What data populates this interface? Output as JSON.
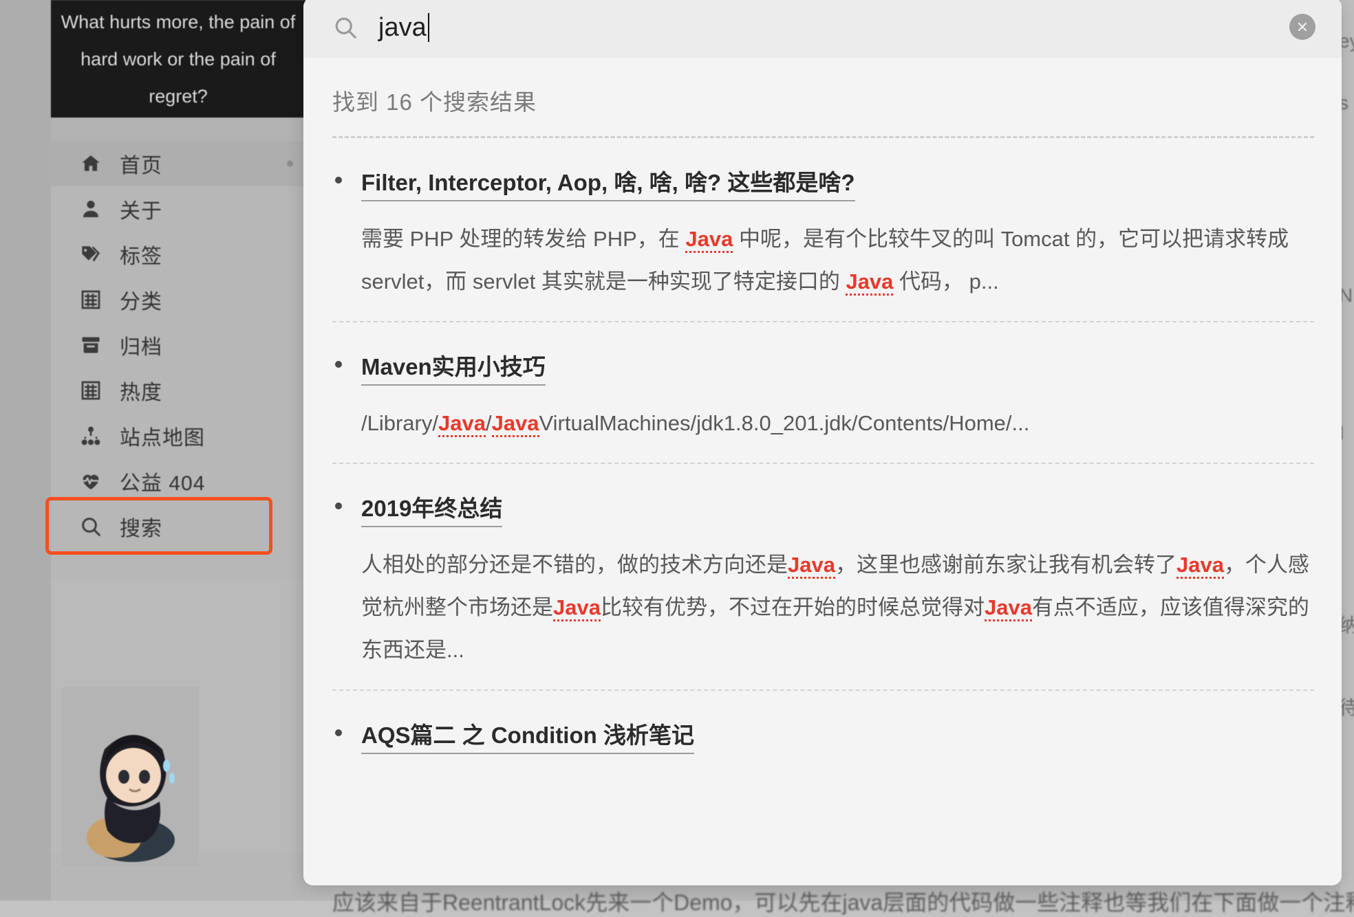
{
  "background": {
    "quote": "What hurts more, the pain of hard work or the pain of regret?",
    "nav_items": [
      {
        "label": "首页",
        "icon": "home-icon",
        "active": true,
        "dot": true
      },
      {
        "label": "关于",
        "icon": "person-icon",
        "active": false,
        "dot": false
      },
      {
        "label": "标签",
        "icon": "tag-icon",
        "active": false,
        "dot": false
      },
      {
        "label": "分类",
        "icon": "grid-icon",
        "active": false,
        "dot": false
      },
      {
        "label": "归档",
        "icon": "archive-icon",
        "active": false,
        "dot": false
      },
      {
        "label": "热度",
        "icon": "grid-icon",
        "active": false,
        "dot": false
      },
      {
        "label": "站点地图",
        "icon": "sitemap-icon",
        "active": false,
        "dot": false
      },
      {
        "label": "公益 404",
        "icon": "heartbeat-icon",
        "active": false,
        "dot": false
      },
      {
        "label": "搜索",
        "icon": "search-icon",
        "active": false,
        "dot": false
      }
    ],
    "highlight_color": "#f4501e",
    "highlighted_nav_label": "搜索",
    "bleed_text_below_modal": "应该来自于ReentrantLock先来一个Demo，可以先在java层面的代码做一些注释也等我们在下面做一个注释和"
  },
  "modal": {
    "search": {
      "icon": "search-icon",
      "value": "java",
      "placeholder": "搜索"
    },
    "close_icon": "close-icon",
    "result_count_text": "找到 16 个搜索结果",
    "results": [
      {
        "title": "Filter, Interceptor, Aop, 啥, 啥, 啥? 这些都是啥?",
        "snippet_parts": [
          {
            "t": "需要 PHP 处理的转发给 PHP，在 ",
            "h": false
          },
          {
            "t": "Java",
            "h": true
          },
          {
            "t": " 中呢，是有个比较牛叉的叫 Tomcat 的，它可以把请求转成 servlet，而 servlet 其实就是一种实现了特定接口的 ",
            "h": false
          },
          {
            "t": "Java",
            "h": true
          },
          {
            "t": " 代码， p...",
            "h": false
          }
        ]
      },
      {
        "title": "Maven实用小技巧",
        "snippet_parts": [
          {
            "t": "/Library/",
            "h": false
          },
          {
            "t": "Java",
            "h": true
          },
          {
            "t": "/",
            "h": false
          },
          {
            "t": "Java",
            "h": true
          },
          {
            "t": "VirtualMachines/jdk1.8.0_201.jdk/Contents/Home/...",
            "h": false
          }
        ]
      },
      {
        "title": "2019年终总结",
        "snippet_parts": [
          {
            "t": "人相处的部分还是不错的，做的技术方向还是",
            "h": false
          },
          {
            "t": "Java",
            "h": true
          },
          {
            "t": "，这里也感谢前东家让我有机会转了",
            "h": false
          },
          {
            "t": "Java",
            "h": true
          },
          {
            "t": "，个人感觉杭州整个市场还是",
            "h": false
          },
          {
            "t": "Java",
            "h": true
          },
          {
            "t": "比较有优势，不过在开始的时候总觉得对",
            "h": false
          },
          {
            "t": "Java",
            "h": true
          },
          {
            "t": "有点不适应，应该值得深究的东西还是...",
            "h": false
          }
        ]
      },
      {
        "title": "AQS篇二 之 Condition 浅析笔记",
        "snippet_parts": []
      }
    ]
  },
  "colors": {
    "highlight_red": "#e8392b",
    "annotation_red": "#f4501e",
    "modal_bg": "#f4f4f4",
    "header_bg": "#ececec"
  }
}
